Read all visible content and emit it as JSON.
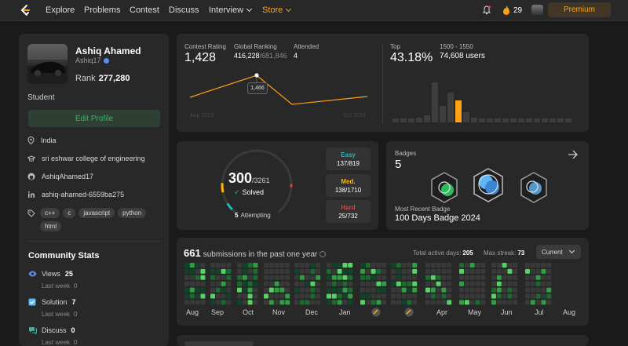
{
  "nav": {
    "links": [
      "Explore",
      "Problems",
      "Contest",
      "Discuss"
    ],
    "interview": "Interview",
    "store": "Store",
    "streak": "29",
    "premium": "Premium"
  },
  "profile": {
    "name": "Ashiq Ahamed",
    "username": "Ashiq17",
    "rank_label": "Rank",
    "rank": "277,280",
    "occupation": "Student",
    "edit_button": "Edit Profile",
    "location": "India",
    "school": "sri eshwar college of engineering",
    "github": "AshiqAhamed17",
    "linkedin": "ashiq-ahamed-6559ba275",
    "skills": [
      "c++",
      "c",
      "javascript",
      "python",
      "html"
    ]
  },
  "community": {
    "title": "Community Stats",
    "views": {
      "label": "Views",
      "value": "25",
      "last_week_label": "Last week",
      "last_week": "0"
    },
    "solution": {
      "label": "Solution",
      "value": "7",
      "last_week_label": "Last week",
      "last_week": "0"
    },
    "discuss": {
      "label": "Discuss",
      "value": "0",
      "last_week_label": "Last week",
      "last_week": "0"
    }
  },
  "contest": {
    "rating_label": "Contest Rating",
    "rating": "1,428",
    "global_label": "Global Ranking",
    "global_rank": "416,228",
    "global_total": "/681,846",
    "attended_label": "Attended",
    "attended": "4",
    "tooltip": "1,466",
    "start_label": "Aug 2023",
    "end_label": "Oct 2023",
    "top_label": "Top",
    "top_pct": "43.18%",
    "range_label": "1500 - 1550",
    "range_users": "74,608 users"
  },
  "solved": {
    "solved": "300",
    "total": "/3261",
    "label": "Solved",
    "attempting_count": "5",
    "attempting_label": "Attempting",
    "easy": {
      "label": "Easy",
      "value": "137/819",
      "color": "#1cbaba"
    },
    "medium": {
      "label": "Med.",
      "value": "138/1710",
      "color": "#ffb700"
    },
    "hard": {
      "label": "Hard",
      "value": "25/732",
      "color": "#f63737"
    }
  },
  "badges": {
    "label": "Badges",
    "count": "5",
    "recent_label": "Most Recent Badge",
    "recent": "100 Days Badge 2024"
  },
  "submissions": {
    "count": "661",
    "title": "submissions in the past one year",
    "active_label": "Total active days:",
    "active_days": "205",
    "streak_label": "Max streak:",
    "max_streak": "73",
    "dropdown": "Current",
    "months": [
      "Aug",
      "Sep",
      "Oct",
      "Nov",
      "Dec",
      "Jan",
      "Apr",
      "May",
      "Jun",
      "Jul",
      "Aug"
    ]
  },
  "colors": {
    "accent": "#ffa116",
    "green": "#2cbb5d"
  }
}
